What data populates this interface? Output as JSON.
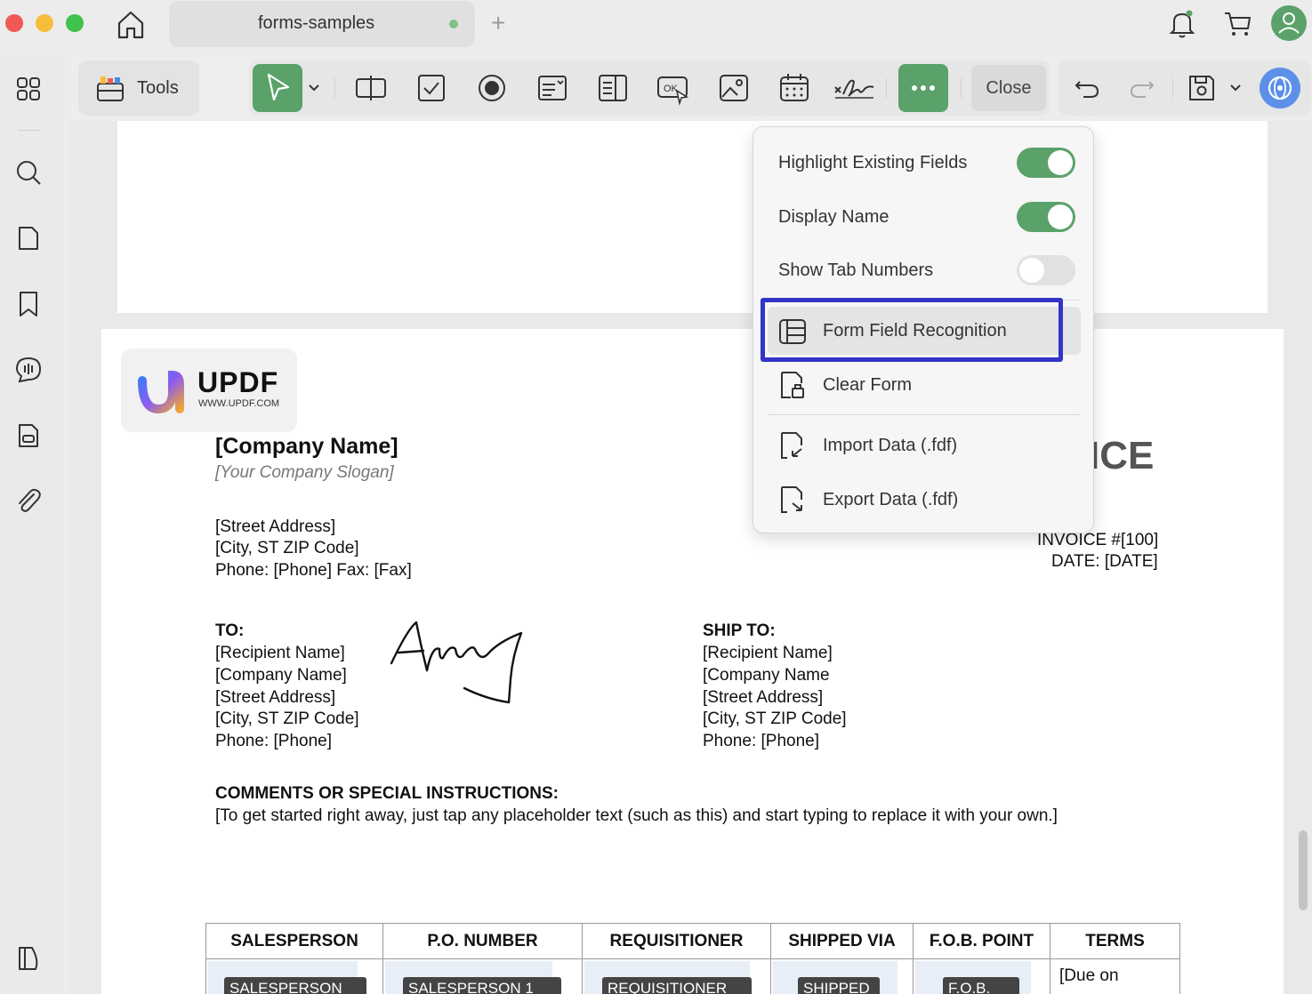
{
  "titlebar": {
    "tab_title": "forms-samples",
    "new_tab": "+"
  },
  "toolbar": {
    "tools_label": "Tools",
    "close_label": "Close",
    "accent_color": "#5aa26a"
  },
  "dropdown": {
    "toggles": [
      {
        "label": "Highlight Existing Fields",
        "on": true
      },
      {
        "label": "Display Name",
        "on": true
      },
      {
        "label": "Show Tab Numbers",
        "on": false
      }
    ],
    "items": [
      {
        "label": "Form Field Recognition",
        "icon": "form-field-recognition-icon",
        "highlighted": true
      },
      {
        "label": "Clear Form",
        "icon": "clear-form-icon"
      },
      {
        "label": "Import Data (.fdf)",
        "icon": "import-data-icon"
      },
      {
        "label": "Export Data (.fdf)",
        "icon": "export-data-icon"
      }
    ],
    "highlight_color": "#3534c8"
  },
  "invoice": {
    "logo": {
      "word": "UPDF",
      "url": "WWW.UPDF.COM"
    },
    "company_name": "[Company Name]",
    "slogan": "[Your Company Slogan]",
    "address": [
      "[Street Address]",
      "[City, ST ZIP Code]",
      "Phone: [Phone]  Fax: [Fax]"
    ],
    "title_fragment": "ICE",
    "invoice_number": "INVOICE #[100]",
    "date": "DATE: [DATE]",
    "to": {
      "heading": "TO:",
      "lines": [
        "[Recipient Name]",
        "[Company Name]",
        "[Street Address]",
        "[City, ST ZIP Code]",
        "Phone: [Phone]"
      ]
    },
    "ship_to": {
      "heading": "SHIP TO:",
      "lines": [
        "[Recipient Name]",
        "[Company Name",
        "[Street Address]",
        "[City, ST ZIP Code]",
        "Phone: [Phone]"
      ]
    },
    "comments_heading": "COMMENTS OR SPECIAL INSTRUCTIONS:",
    "comments_text": "[To get started right away, just tap any placeholder text (such as this) and start typing to replace it with your own.]",
    "table": {
      "headers": [
        "SALESPERSON",
        "P.O. NUMBER",
        "REQUISITIONER",
        "SHIPPED VIA",
        "F.O.B. POINT",
        "TERMS"
      ],
      "field_names": [
        "SALESPERSON",
        "SALESPERSON 1",
        "REQUISITIONER",
        "SHIPPED",
        "F.O.B.",
        "[Due on"
      ]
    }
  }
}
